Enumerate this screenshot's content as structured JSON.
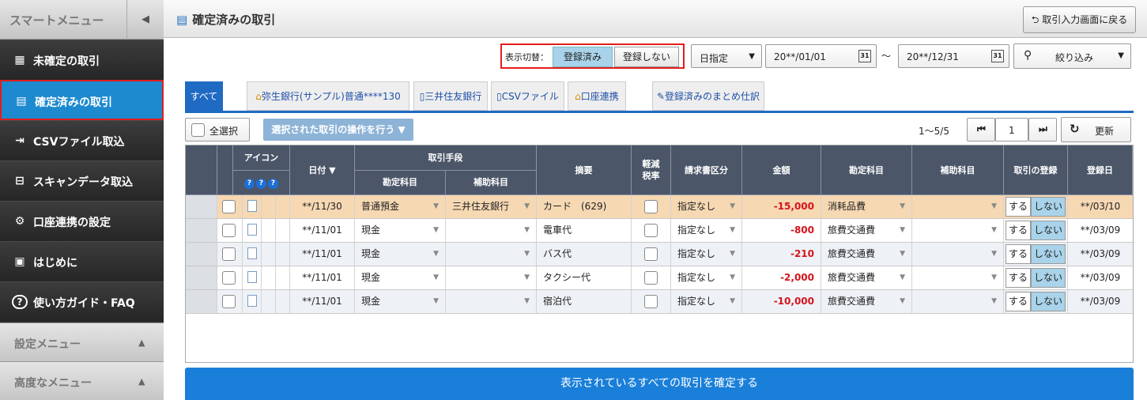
{
  "sidebar": {
    "title": "スマートメニュー",
    "collapse": "◀",
    "items": [
      {
        "label": "未確定の取引",
        "icon": "▦"
      },
      {
        "label": "確定済みの取引",
        "icon": "▤"
      },
      {
        "label": "CSVファイル取込",
        "icon": "⇥"
      },
      {
        "label": "スキャンデータ取込",
        "icon": "⊟"
      },
      {
        "label": "口座連携の設定",
        "icon": "⚙"
      },
      {
        "label": "はじめに",
        "icon": "▣"
      },
      {
        "label": "使い方ガイド・FAQ",
        "icon": "?"
      }
    ],
    "sections": [
      {
        "label": "設定メニュー",
        "tri": "▲"
      },
      {
        "label": "高度なメニュー",
        "tri": "▲"
      }
    ]
  },
  "header": {
    "title": "確定済みの取引",
    "back_label": "取引入力画面に戻る"
  },
  "filters": {
    "toggle_label": "表示切替：",
    "registered": "登録済み",
    "not_registered": "登録しない",
    "date_mode": "日指定",
    "date_from": "20**/01/01",
    "tilde": "〜",
    "date_to": "20**/12/31",
    "cal": "31",
    "narrow": "絞り込み"
  },
  "tabs": [
    "すべて",
    "弥生銀行(サンプル)普通****130",
    "三井住友銀行",
    "CSVファイル",
    "口座連携",
    "登録済みのまとめ仕訳"
  ],
  "controls": {
    "select_all": "全選択",
    "bulk_op": "選択された取引の操作を行う ▼",
    "range": "1〜5/5",
    "page": "1",
    "refresh": "更新"
  },
  "table": {
    "headers": {
      "icon": "アイコン",
      "date": "日付 ▼",
      "method": "取引手段",
      "account": "勘定科目",
      "subaccount": "補助科目",
      "memo": "摘要",
      "reduced": "軽減税率",
      "invoice": "請求書区分",
      "amount": "金額",
      "acct2": "勘定科目",
      "sub2": "補助科目",
      "registration": "取引の登録",
      "regdate": "登録日",
      "q": "?"
    },
    "rows": [
      {
        "date": "**/11/30",
        "account": "普通預金",
        "sub": "三井住友銀行",
        "memo": "カード　(629)",
        "invoice": "指定なし",
        "amount": "-15,000",
        "acct2": "消耗品費",
        "reg_do": "する",
        "reg_not": "しない",
        "regdate": "**/03/10"
      },
      {
        "date": "**/11/01",
        "account": "現金",
        "sub": "",
        "memo": "電車代",
        "invoice": "指定なし",
        "amount": "-800",
        "acct2": "旅費交通費",
        "reg_do": "する",
        "reg_not": "しない",
        "regdate": "**/03/09"
      },
      {
        "date": "**/11/01",
        "account": "現金",
        "sub": "",
        "memo": "バス代",
        "invoice": "指定なし",
        "amount": "-210",
        "acct2": "旅費交通費",
        "reg_do": "する",
        "reg_not": "しない",
        "regdate": "**/03/09"
      },
      {
        "date": "**/11/01",
        "account": "現金",
        "sub": "",
        "memo": "タクシー代",
        "invoice": "指定なし",
        "amount": "-2,000",
        "acct2": "旅費交通費",
        "reg_do": "する",
        "reg_not": "しない",
        "regdate": "**/03/09"
      },
      {
        "date": "**/11/01",
        "account": "現金",
        "sub": "",
        "memo": "宿泊代",
        "invoice": "指定なし",
        "amount": "-10,000",
        "acct2": "旅費交通費",
        "reg_do": "する",
        "reg_not": "しない",
        "regdate": "**/03/09"
      }
    ]
  },
  "confirm_label": "表示されているすべての取引を確定する",
  "colors": {
    "accent": "#1f6ac2",
    "highlight_row": "#f6d8b3",
    "negative": "#d4141c",
    "active_border": "#e41c1c"
  }
}
